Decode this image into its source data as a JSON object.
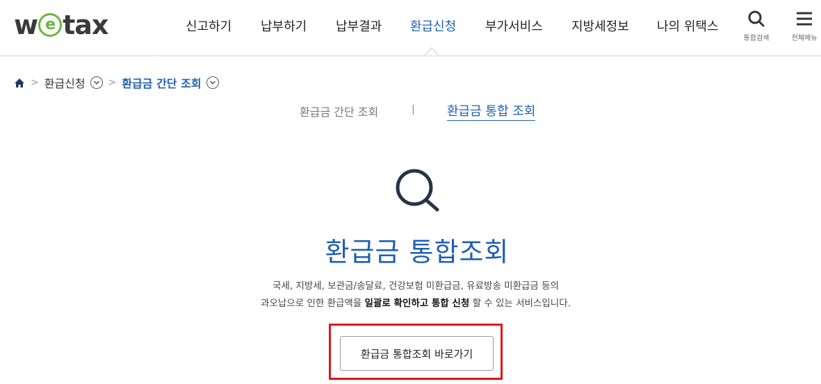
{
  "header": {
    "logo_pre": "w",
    "logo_e": "e",
    "logo_post": "tax",
    "nav": [
      "신고하기",
      "납부하기",
      "납부결과",
      "환급신청",
      "부가서비스",
      "지방세정보",
      "나의 위택스"
    ],
    "active_nav": "환급신청",
    "search_label": "통합검색",
    "menu_label": "전체메뉴"
  },
  "breadcrumb": {
    "level1": "환급신청",
    "current": "환급금 간단 조회"
  },
  "tabs": {
    "simple": "환급금 간단 조회",
    "divider": "|",
    "integrated": "환급금 통합 조회"
  },
  "main": {
    "title": "환급금 통합조회",
    "desc_line1": "국세, 지방세, 보관금/송달료, 건강보험 미환급금, 유료방송 미환급금 등의",
    "desc_line2_pre": "과오납으로 인한 환급액을 ",
    "desc_line2_bold1": "일괄로 확인하고 통합 신청",
    "desc_line2_post": " 할 수 있는 서비스입니다.",
    "button_label": "환급금 통합조회 바로가기"
  },
  "colors": {
    "accent": "#1e5fb3",
    "logo_green": "#6cb33f",
    "highlight_red": "#e3141c"
  }
}
